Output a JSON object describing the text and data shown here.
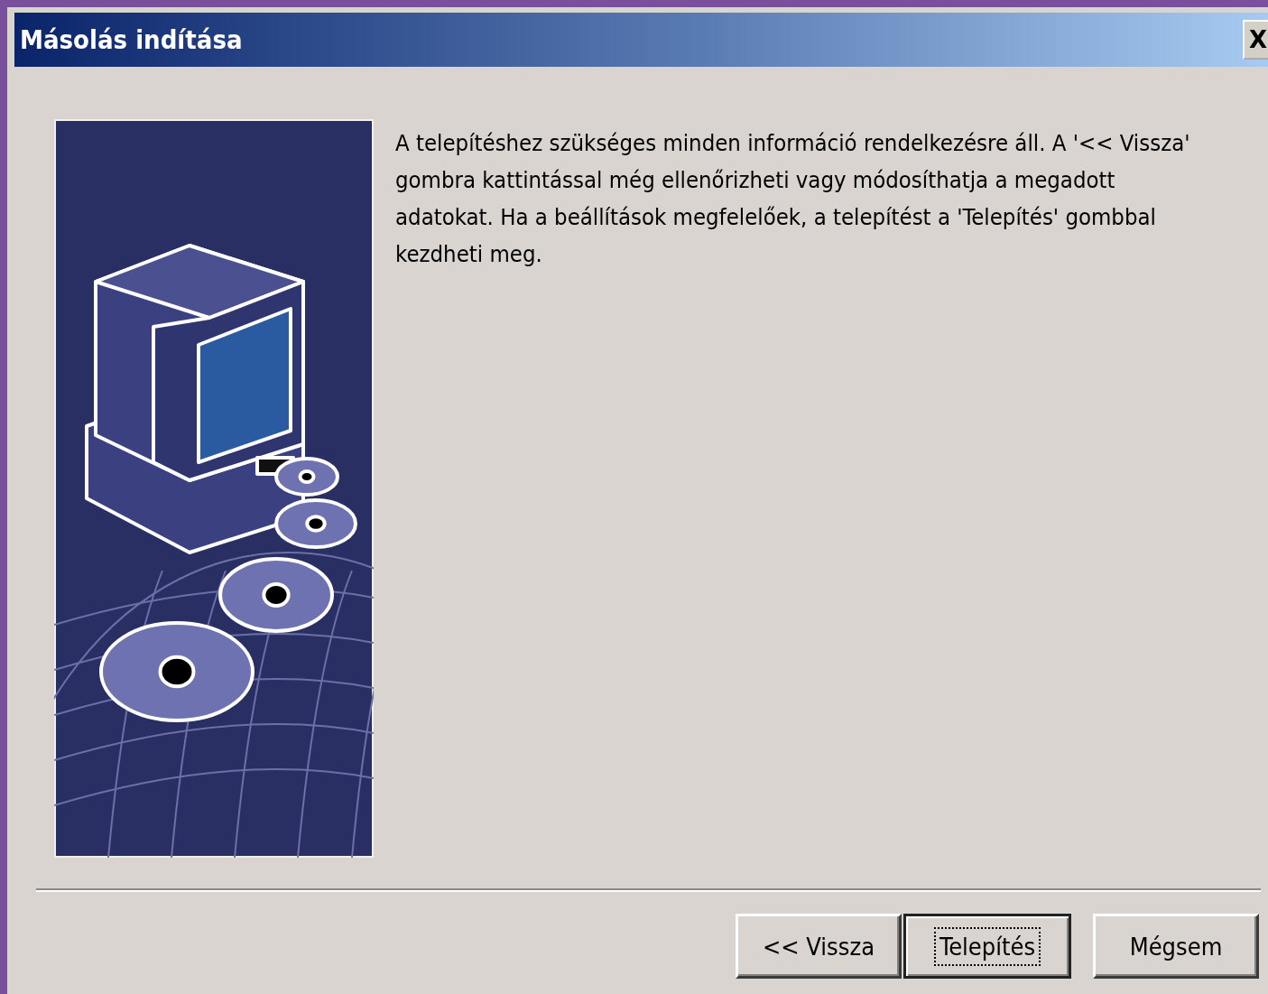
{
  "window": {
    "title": "Másolás indítása",
    "close_label": "X"
  },
  "message": "A telepítéshez szükséges minden információ rendelkezésre áll. A '<< Vissza' gombra kattintással még ellenőrizheti vagy módosíthatja a megadott adatokat. Ha a beállítások megfelelőek, a telepítést a 'Telepítés' gombbal kezdheti meg.",
  "buttons": [
    {
      "label": "<< Vissza",
      "default": false
    },
    {
      "label": "Telepítés",
      "default": true
    },
    {
      "label": "Mégsem",
      "default": false
    }
  ]
}
